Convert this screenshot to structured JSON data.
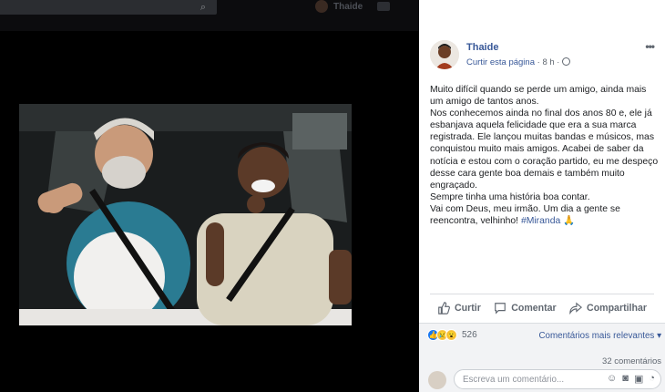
{
  "topbar": {
    "user_name": "Thaide"
  },
  "post": {
    "author": "Thaide",
    "like_page": "Curtir esta página",
    "time": "8 h",
    "separator": " · ",
    "paragraphs": [
      "Muito difícil quando se perde um amigo, ainda mais um amigo de tantos anos.",
      "Nos conhecemos ainda no final dos anos 80 e, ele já esbanjava aquela felicidade que era a sua marca registrada. Ele lançou muitas bandas e músicos, mas conquistou muito mais amigos. Acabei de saber da notícia e estou com o coração partido, eu me despeço desse cara gente boa demais e também muito engraçado.",
      "Sempre tinha uma história boa contar.",
      "Vai com Deus, meu irmão. Um dia a gente se reencontra, velhinho!"
    ],
    "hashtag": "#Miranda",
    "emoji": "🙏"
  },
  "actions": {
    "like": "Curtir",
    "comment": "Comentar",
    "share": "Compartilhar"
  },
  "stats": {
    "reaction_count": "526",
    "sort_label": "Comentários mais relevantes",
    "comments_count": "32 comentários"
  },
  "comment": {
    "placeholder": "Escreva um comentário..."
  },
  "colors": {
    "link": "#385898",
    "like_blue": "#1877f2"
  }
}
